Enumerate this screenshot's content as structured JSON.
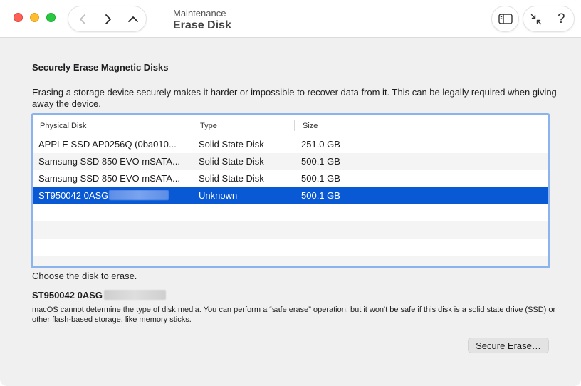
{
  "toolbar": {
    "breadcrumb_parent": "Maintenance",
    "page_title": "Erase Disk",
    "help_label": "?"
  },
  "section": {
    "title": "Securely Erase Magnetic Disks",
    "description": "Erasing a storage device securely makes it harder or impossible to recover data from it. This can be legally required when giving away the device."
  },
  "table": {
    "columns": [
      "Physical Disk",
      "Type",
      "Size"
    ],
    "rows": [
      {
        "disk": "APPLE SSD AP0256Q (0ba010...",
        "type": "Solid State Disk",
        "size": "251.0 GB"
      },
      {
        "disk": "Samsung SSD 850 EVO mSATA...",
        "type": "Solid State Disk",
        "size": "500.1 GB"
      },
      {
        "disk": "Samsung SSD 850 EVO mSATA...",
        "type": "Solid State Disk",
        "size": "500.1 GB"
      },
      {
        "disk": "ST950042 0ASG",
        "type": "Unknown",
        "size": "500.1 GB"
      }
    ]
  },
  "hint": "Choose the disk to erase.",
  "selected": {
    "name": "ST950042 0ASG",
    "warning": "macOS cannot determine the type of disk media. You can perform a “safe erase” operation, but it won't be safe if this disk is a solid state drive (SSD) or other flash-based storage, like memory sticks."
  },
  "actions": {
    "erase_label": "Secure Erase…"
  },
  "colors": {
    "selection": "#0959d4",
    "focus_ring": "#8bb4ee",
    "close": "#fe5f57",
    "minimize": "#febc2e",
    "zoom": "#28c840"
  },
  "icons": {
    "back": "chevron-left-icon",
    "forward": "chevron-right-icon",
    "up": "chevron-up-icon",
    "sidebar": "sidebar-toggle-icon",
    "collapse": "collapse-arrows-icon"
  }
}
